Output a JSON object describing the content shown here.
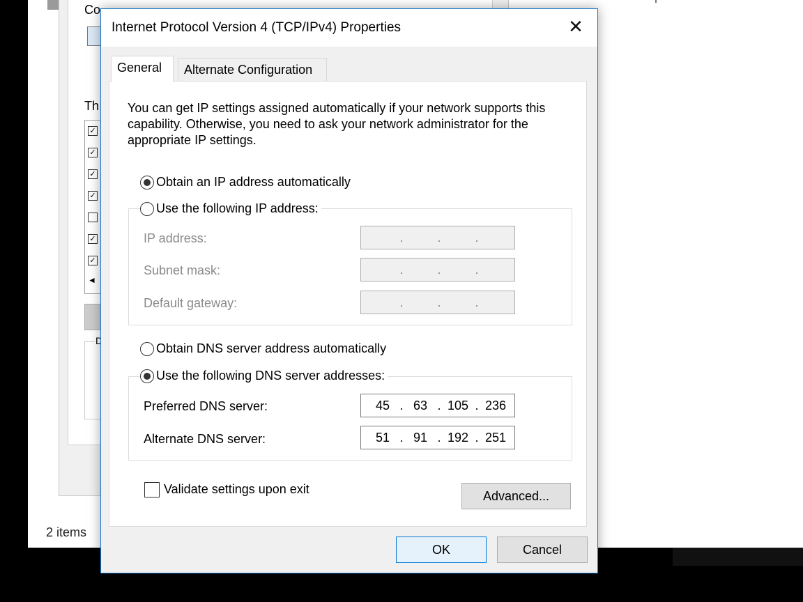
{
  "background": {
    "status_text": "2 items",
    "props_label_1": "Co",
    "props_label_2": "Th",
    "props_group_label": "D",
    "list_checks": [
      "✓",
      "✓",
      "✓",
      "✓",
      "",
      "✓",
      "✓"
    ],
    "list_arrow": "◄"
  },
  "dialog": {
    "title": "Internet Protocol Version 4 (TCP/IPv4) Properties",
    "close_glyph": "✕",
    "tabs": [
      {
        "label": "General",
        "active": true
      },
      {
        "label": "Alternate Configuration",
        "active": false
      }
    ],
    "intro_text": "You can get IP settings assigned automatically if your network supports this capability. Otherwise, you need to ask your network administrator for the appropriate IP settings.",
    "ip": {
      "auto_label": "Obtain an IP address automatically",
      "auto_selected": true,
      "manual_label": "Use the following IP address:",
      "manual_selected": false,
      "fields": [
        {
          "label": "IP address:",
          "octets": [
            "",
            "",
            "",
            ""
          ]
        },
        {
          "label": "Subnet mask:",
          "octets": [
            "",
            "",
            "",
            ""
          ]
        },
        {
          "label": "Default gateway:",
          "octets": [
            "",
            "",
            "",
            ""
          ]
        }
      ]
    },
    "dns": {
      "auto_label": "Obtain DNS server address automatically",
      "auto_selected": false,
      "manual_label": "Use the following DNS server addresses:",
      "manual_selected": true,
      "fields": [
        {
          "label": "Preferred DNS server:",
          "octets": [
            "45",
            "63",
            "105",
            "236"
          ]
        },
        {
          "label": "Alternate DNS server:",
          "octets": [
            "51",
            "91",
            "192",
            "251"
          ]
        }
      ]
    },
    "validate_label": "Validate settings upon exit",
    "validate_checked": false,
    "advanced_label": "Advanced...",
    "ok_label": "OK",
    "cancel_label": "Cancel"
  },
  "colors": {
    "accent": "#0078d7",
    "dialog_border": "#1979ca",
    "disabled_text": "#8a8a8a"
  }
}
